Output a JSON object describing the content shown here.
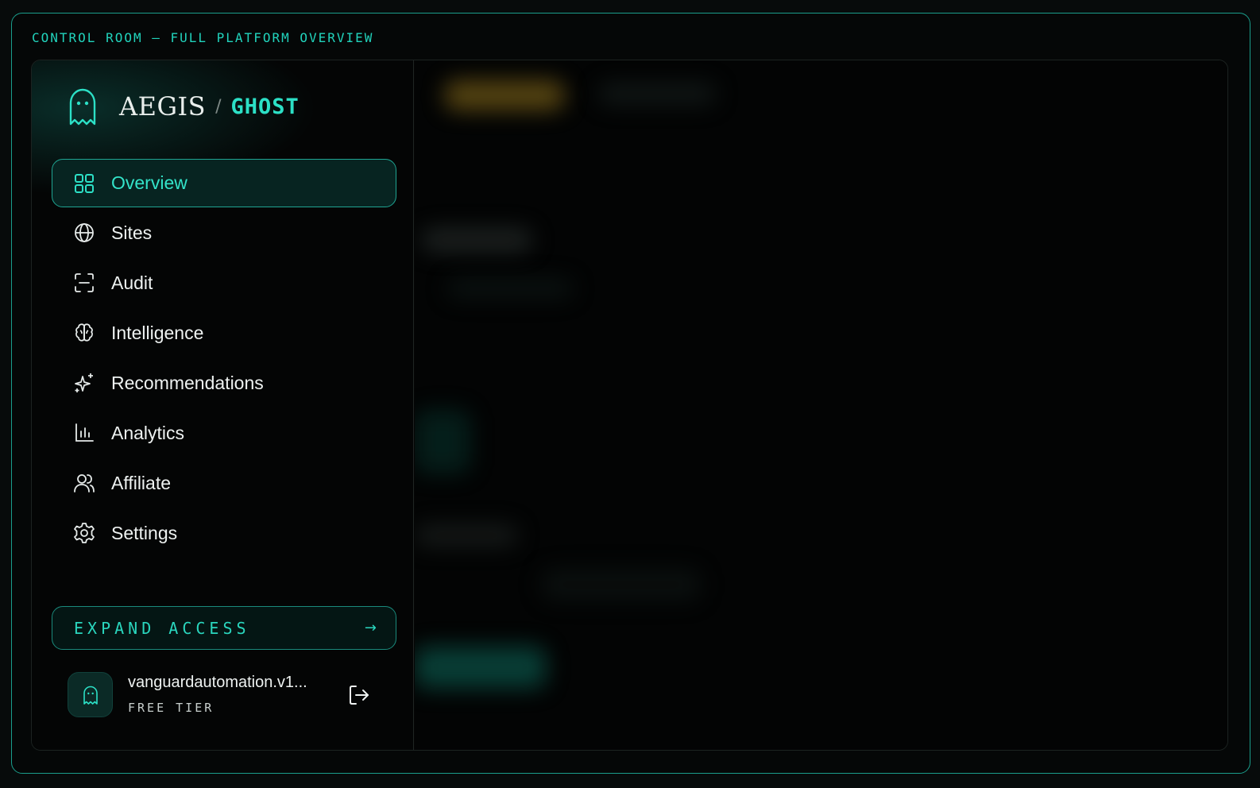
{
  "frame": {
    "title": "CONTROL ROOM — FULL PLATFORM OVERVIEW"
  },
  "brand": {
    "name": "AEGIS",
    "separator": "/",
    "product": "GHOST",
    "icon": "ghost-icon"
  },
  "nav": {
    "items": [
      {
        "label": "Overview",
        "icon": "grid-icon",
        "active": true
      },
      {
        "label": "Sites",
        "icon": "globe-icon",
        "active": false
      },
      {
        "label": "Audit",
        "icon": "scan-icon",
        "active": false
      },
      {
        "label": "Intelligence",
        "icon": "brain-icon",
        "active": false
      },
      {
        "label": "Recommendations",
        "icon": "sparkles-icon",
        "active": false
      },
      {
        "label": "Analytics",
        "icon": "bar-chart-icon",
        "active": false
      },
      {
        "label": "Affiliate",
        "icon": "users-icon",
        "active": false
      },
      {
        "label": "Settings",
        "icon": "gear-icon",
        "active": false
      }
    ]
  },
  "expand": {
    "label": "EXPAND ACCESS",
    "arrow": "→"
  },
  "user": {
    "name": "vanguardautomation.v1...",
    "tier": "FREE TIER"
  },
  "colors": {
    "accent": "#2ce0c6",
    "border": "#1a9e8c",
    "background": "#050707"
  }
}
